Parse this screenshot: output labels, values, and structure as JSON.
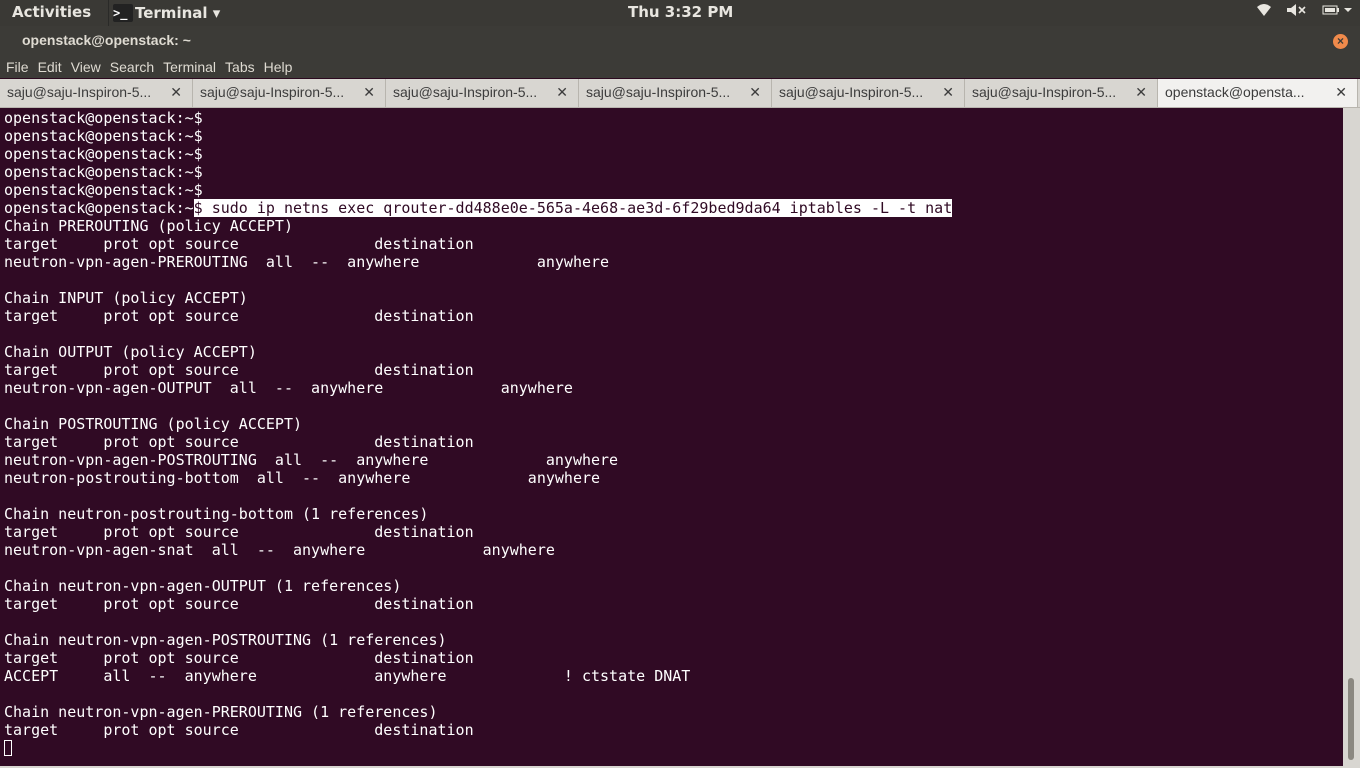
{
  "top_panel": {
    "activities": "Activities",
    "app_menu": "Terminal ▾",
    "app_icon": ">_",
    "clock": "Thu  3:32 PM",
    "tray_icons": [
      "wifi-icon",
      "volume-icon",
      "battery-icon"
    ]
  },
  "window": {
    "title": "openstack@openstack: ~",
    "close": "×"
  },
  "menubar": {
    "items": [
      "File",
      "Edit",
      "View",
      "Search",
      "Terminal",
      "Tabs",
      "Help"
    ]
  },
  "tabs": [
    {
      "label": "saju@saju-Inspiron-5...",
      "close": "✕"
    },
    {
      "label": "saju@saju-Inspiron-5...",
      "close": "✕"
    },
    {
      "label": "saju@saju-Inspiron-5...",
      "close": "✕"
    },
    {
      "label": "saju@saju-Inspiron-5...",
      "close": "✕"
    },
    {
      "label": "saju@saju-Inspiron-5...",
      "close": "✕"
    },
    {
      "label": "saju@saju-Inspiron-5...",
      "close": "✕"
    },
    {
      "label": "openstack@opensta...",
      "close": "✕"
    }
  ],
  "terminal": {
    "prompt": "openstack@openstack:~",
    "command": "$ sudo ip netns exec qrouter-dd488e0e-565a-4e68-ae3d-6f29bed9da64 iptables -L -t nat",
    "lines": [
      "openstack@openstack:~$",
      "openstack@openstack:~$",
      "openstack@openstack:~$",
      "openstack@openstack:~$",
      "openstack@openstack:~$",
      "",
      "Chain PREROUTING (policy ACCEPT)",
      "target     prot opt source               destination",
      "neutron-vpn-agen-PREROUTING  all  --  anywhere             anywhere",
      "",
      "Chain INPUT (policy ACCEPT)",
      "target     prot opt source               destination",
      "",
      "Chain OUTPUT (policy ACCEPT)",
      "target     prot opt source               destination",
      "neutron-vpn-agen-OUTPUT  all  --  anywhere             anywhere",
      "",
      "Chain POSTROUTING (policy ACCEPT)",
      "target     prot opt source               destination",
      "neutron-vpn-agen-POSTROUTING  all  --  anywhere             anywhere",
      "neutron-postrouting-bottom  all  --  anywhere             anywhere",
      "",
      "Chain neutron-postrouting-bottom (1 references)",
      "target     prot opt source               destination",
      "neutron-vpn-agen-snat  all  --  anywhere             anywhere",
      "",
      "Chain neutron-vpn-agen-OUTPUT (1 references)",
      "target     prot opt source               destination",
      "",
      "Chain neutron-vpn-agen-POSTROUTING (1 references)",
      "target     prot opt source               destination",
      "ACCEPT     all  --  anywhere             anywhere             ! ctstate DNAT",
      "",
      "Chain neutron-vpn-agen-PREROUTING (1 references)",
      "target     prot opt source               destination"
    ]
  }
}
